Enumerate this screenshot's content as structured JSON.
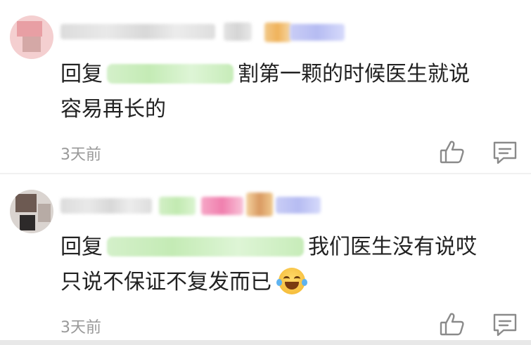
{
  "comments": [
    {
      "reply_prefix": "回复",
      "text_line1": "割第一颗的时候医生就说",
      "text_line2": "容易再长的",
      "time": "3天前"
    },
    {
      "reply_prefix": "回复",
      "text_line1": "我们医生没有说哎",
      "text_line2": "只说不保证不复发而已",
      "emoji": "laughing-tears-emoji",
      "time": "3天前"
    }
  ],
  "icons": {
    "like": "thumbs-up-icon",
    "reply": "comment-icon"
  }
}
